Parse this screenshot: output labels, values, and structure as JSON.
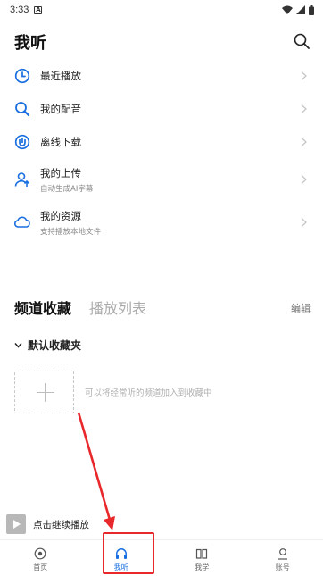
{
  "status_bar": {
    "time": "3:33",
    "notification_letter": "A"
  },
  "header": {
    "title": "我听"
  },
  "menu": [
    {
      "label": "最近播放",
      "sub": ""
    },
    {
      "label": "我的配音",
      "sub": ""
    },
    {
      "label": "离线下载",
      "sub": ""
    },
    {
      "label": "我的上传",
      "sub": "自动生成AI字幕"
    },
    {
      "label": "我的资源",
      "sub": "支持播放本地文件"
    }
  ],
  "tabs": {
    "active": "频道收藏",
    "inactive": "播放列表",
    "edit": "编辑"
  },
  "folder": {
    "name": "默认收藏夹"
  },
  "empty_hint": "可以将经常听的频道加入到收藏中",
  "player": {
    "text": "点击继续播放"
  },
  "bottom_nav": [
    {
      "label": "首页",
      "icon": "home-icon"
    },
    {
      "label": "我听",
      "icon": "headphones-icon"
    },
    {
      "label": "我学",
      "icon": "book-icon"
    },
    {
      "label": "账号",
      "icon": "account-icon"
    }
  ],
  "colors": {
    "accent": "#1a6fe0",
    "annotation": "#e8282b"
  }
}
